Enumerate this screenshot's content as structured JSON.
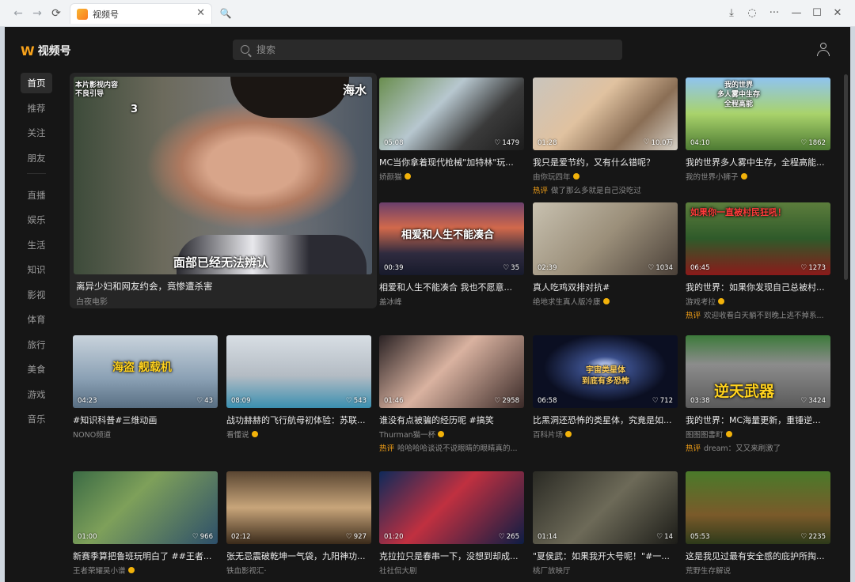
{
  "browser": {
    "tab_title": "视频号",
    "nav_back": "←",
    "nav_forward": "→",
    "nav_reload": "⟳",
    "tab_close": "✕",
    "search_icon": "🔍",
    "download_icon": "⤓",
    "globe_icon": "◌",
    "more": "···",
    "minimize": "—",
    "maximize": "☐",
    "close": "✕"
  },
  "app": {
    "logo_mark": "W",
    "logo_text": "视频号",
    "search_placeholder": "搜索",
    "colors": {
      "accent": "#f7a21b",
      "hot": "#f3a017",
      "background": "#161616"
    }
  },
  "sidebar": {
    "group1": [
      "首页",
      "推荐",
      "关注",
      "朋友"
    ],
    "group2": [
      "直播",
      "娱乐",
      "生活",
      "知识",
      "影视",
      "体育",
      "旅行",
      "美食",
      "游戏",
      "音乐"
    ]
  },
  "feature": {
    "title": "离异少妇和网友约会，竟惨遭杀害",
    "author": "白夜电影",
    "overlay_top": "本片影视内容\n不良引导",
    "overlay_num": "3",
    "overlay_right": "海水",
    "overlay_caption": "面部已经无法辨认"
  },
  "cards": [
    {
      "dur": "05:08",
      "likes": "1479",
      "title": "MC当你拿着现代枪械\"加特林\"玩...",
      "author": "娇颜猫",
      "verified": true,
      "hot": "",
      "overlay": ""
    },
    {
      "dur": "01:28",
      "likes": "10.0万",
      "title": "我只是爱节约，又有什么错呢？",
      "author": "由你玩四年",
      "verified": true,
      "hot": "做了那么多就是自己没吃过",
      "overlay": ""
    },
    {
      "dur": "04:10",
      "likes": "1862",
      "title": "我的世界多人雾中生存，全程高能...",
      "author": "我的世界小狮子",
      "verified": true,
      "hot": "",
      "overlay": "我的世界\n多人雾中生存\n全程高能"
    },
    {
      "dur": "00:39",
      "likes": "35",
      "title": "相爱和人生不能凑合 我也不愿意...",
      "author": "盖冰峰",
      "verified": false,
      "hot": "",
      "overlay": "相爱和人生不能凑合"
    },
    {
      "dur": "02:39",
      "likes": "1034",
      "title": "真人吃鸡双排对抗#",
      "author": "绝地求生真人版冷康",
      "verified": true,
      "hot": "",
      "overlay": ""
    },
    {
      "dur": "06:45",
      "likes": "1273",
      "title": "我的世界：如果你发现自己总被村...",
      "author": "游戏考拉",
      "verified": true,
      "hot": "欢迎收看白天躺不到晚上逃不掉系...",
      "overlay": "如果你一直被村民狂吼！"
    },
    {
      "dur": "04:23",
      "likes": "43",
      "title": "#知识科普#三维动画",
      "author": "NONO频道",
      "verified": false,
      "hot": "",
      "overlay": "海盗 舰载机"
    },
    {
      "dur": "08:09",
      "likes": "543",
      "title": "战功赫赫的飞行航母初体验：苏联...",
      "author": "看懂说",
      "verified": true,
      "hot": "",
      "overlay": ""
    },
    {
      "dur": "01:46",
      "likes": "2958",
      "title": "谁没有点被骗的经历呢 #搞笑",
      "author": "Thurman猫一杯",
      "verified": true,
      "hot": "哈哈哈哈谈说不说眼睛的眼睛真的...",
      "overlay": ""
    },
    {
      "dur": "06:58",
      "likes": "712",
      "title": "比黑洞还恐怖的类星体，究竟是如...",
      "author": "百科片场",
      "verified": true,
      "hot": "",
      "overlay": "宇宙类星体\n到底有多恐怖"
    },
    {
      "dur": "03:38",
      "likes": "3424",
      "title": "我的世界：MC海量更新，重锤逆...",
      "author": "图图图書町",
      "verified": true,
      "hot": "dream：又又来刷激了",
      "overlay": "逆天武器"
    },
    {
      "dur": "01:00",
      "likes": "966",
      "title": "新赛季算把鲁班玩明白了 ##王者...",
      "author": "王者荣耀吴小谱",
      "verified": true,
      "hot": "",
      "overlay": ""
    },
    {
      "dur": "02:12",
      "likes": "927",
      "title": "张无忌震破乾坤一气袋，九阳神功...",
      "author": "铁血影视汇·",
      "verified": false,
      "hot": "",
      "overlay": ""
    },
    {
      "dur": "01:20",
      "likes": "265",
      "title": "克拉拉只是春串一下，没想到却成...",
      "author": "社社侃大剧",
      "verified": false,
      "hot": "",
      "overlay": ""
    },
    {
      "dur": "01:14",
      "likes": "14",
      "title": "\"夏侯武：如果我开大号呢！\"#一...",
      "author": "桃厂放映厅",
      "verified": false,
      "hot": "",
      "overlay": ""
    },
    {
      "dur": "05:53",
      "likes": "2235",
      "title": "这是我见过最有安全感的庇护所掏...",
      "author": "荒野生存解说",
      "verified": false,
      "hot": "",
      "overlay": ""
    }
  ],
  "hot_label": "热评"
}
